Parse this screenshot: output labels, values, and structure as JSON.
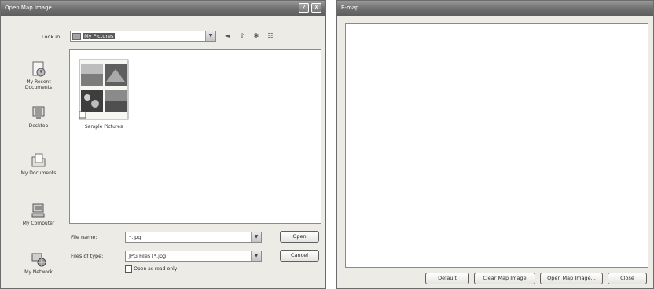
{
  "open_dialog": {
    "title": "Open Map Image...",
    "help_button": "?",
    "close_button": "X",
    "look_in_label": "Look in:",
    "look_in_value": "My Pictures",
    "toolbar_icons": [
      "back-icon",
      "up-folder-icon",
      "new-folder-icon",
      "views-menu-icon"
    ],
    "places": [
      {
        "label": [
          "My Recent",
          "Documents"
        ],
        "icon": "recent-documents-icon"
      },
      {
        "label": [
          "Desktop"
        ],
        "icon": "desktop-icon"
      },
      {
        "label": [
          "My Documents"
        ],
        "icon": "my-documents-icon"
      },
      {
        "label": [
          "My Computer"
        ],
        "icon": "my-computer-icon"
      },
      {
        "label": [
          "My Network"
        ],
        "icon": "my-network-icon"
      }
    ],
    "files": [
      {
        "name": "Sample Pictures",
        "icon": "folder-thumbnail-icon"
      }
    ],
    "file_name_label": "File name:",
    "file_name_value": "*.jpg",
    "file_type_label": "Files of type:",
    "file_type_value": "JPG Files (*.jpg)",
    "open_readonly_label": "Open as read-only",
    "open_readonly_checked": false,
    "open_button": "Open",
    "cancel_button": "Cancel"
  },
  "emap_window": {
    "title": "E-map",
    "buttons": {
      "default": "Default",
      "clear": "Clear Map Image",
      "open": "Open Map Image...",
      "close": "Close"
    }
  },
  "colors": {
    "titlebar": "#6e6e6e",
    "window_face": "#ecebe6",
    "button_border": "#5f5f5f"
  }
}
